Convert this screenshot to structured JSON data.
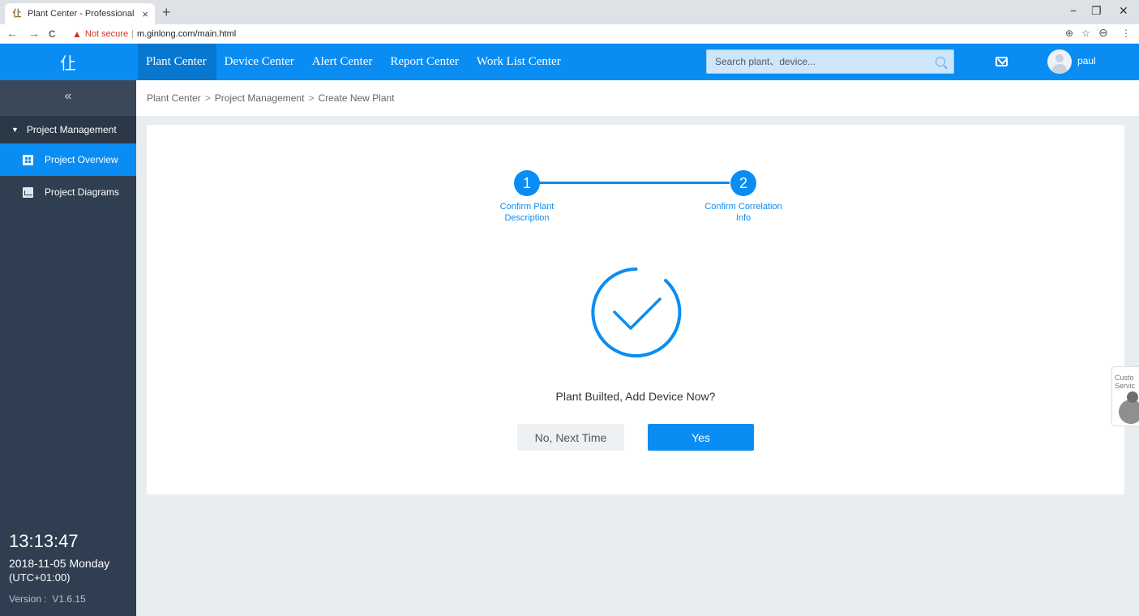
{
  "browser": {
    "tab_title": "Plant Center - Professional",
    "tab_close": "×",
    "new_tab": "+",
    "favicon": "仩",
    "back": "←",
    "forward": "→",
    "reload": "C",
    "warning_icon": "▲",
    "not_secure": "Not secure",
    "separator": "|",
    "url": "m.ginlong.com/main.html",
    "zoom_icon": "⊕",
    "star_icon": "☆",
    "profile_icon": "⊖",
    "menu_icon": "⋮",
    "minimize": "−",
    "restore": "❐",
    "close": "✕"
  },
  "header": {
    "logo": "仩",
    "nav": [
      {
        "label": "Plant Center",
        "active": true
      },
      {
        "label": "Device Center"
      },
      {
        "label": "Alert Center"
      },
      {
        "label": "Report Center"
      },
      {
        "label": "Work List Center"
      }
    ],
    "search_placeholder": "Search plant、device...",
    "username": "paul"
  },
  "sidebar": {
    "collapse": "«",
    "group": "Project Management",
    "items": [
      {
        "label": "Project Overview",
        "active": true
      },
      {
        "label": "Project Diagrams"
      }
    ],
    "clock": {
      "time": "13:13:47",
      "date": "2018-11-05 Monday",
      "timezone": "(UTC+01:00)",
      "version": "Version :  V1.6.15"
    }
  },
  "breadcrumb": [
    "Plant Center",
    "Project Management",
    "Create New Plant"
  ],
  "breadcrumb_sep": ">",
  "wizard": {
    "steps": [
      {
        "number": "1",
        "label_line1": "Confirm Plant",
        "label_line2": "Description"
      },
      {
        "number": "2",
        "label_line1": "Confirm Correlation",
        "label_line2": "Info"
      }
    ],
    "prompt": "Plant Builted, Add Device Now?",
    "no_label": "No, Next Time",
    "yes_label": "Yes"
  },
  "customer_service": {
    "line1": "Custo",
    "line2": "Servic"
  },
  "colors": {
    "accent": "#0a8df3",
    "sidebar": "#2f3e50",
    "background": "#e9edf0"
  }
}
